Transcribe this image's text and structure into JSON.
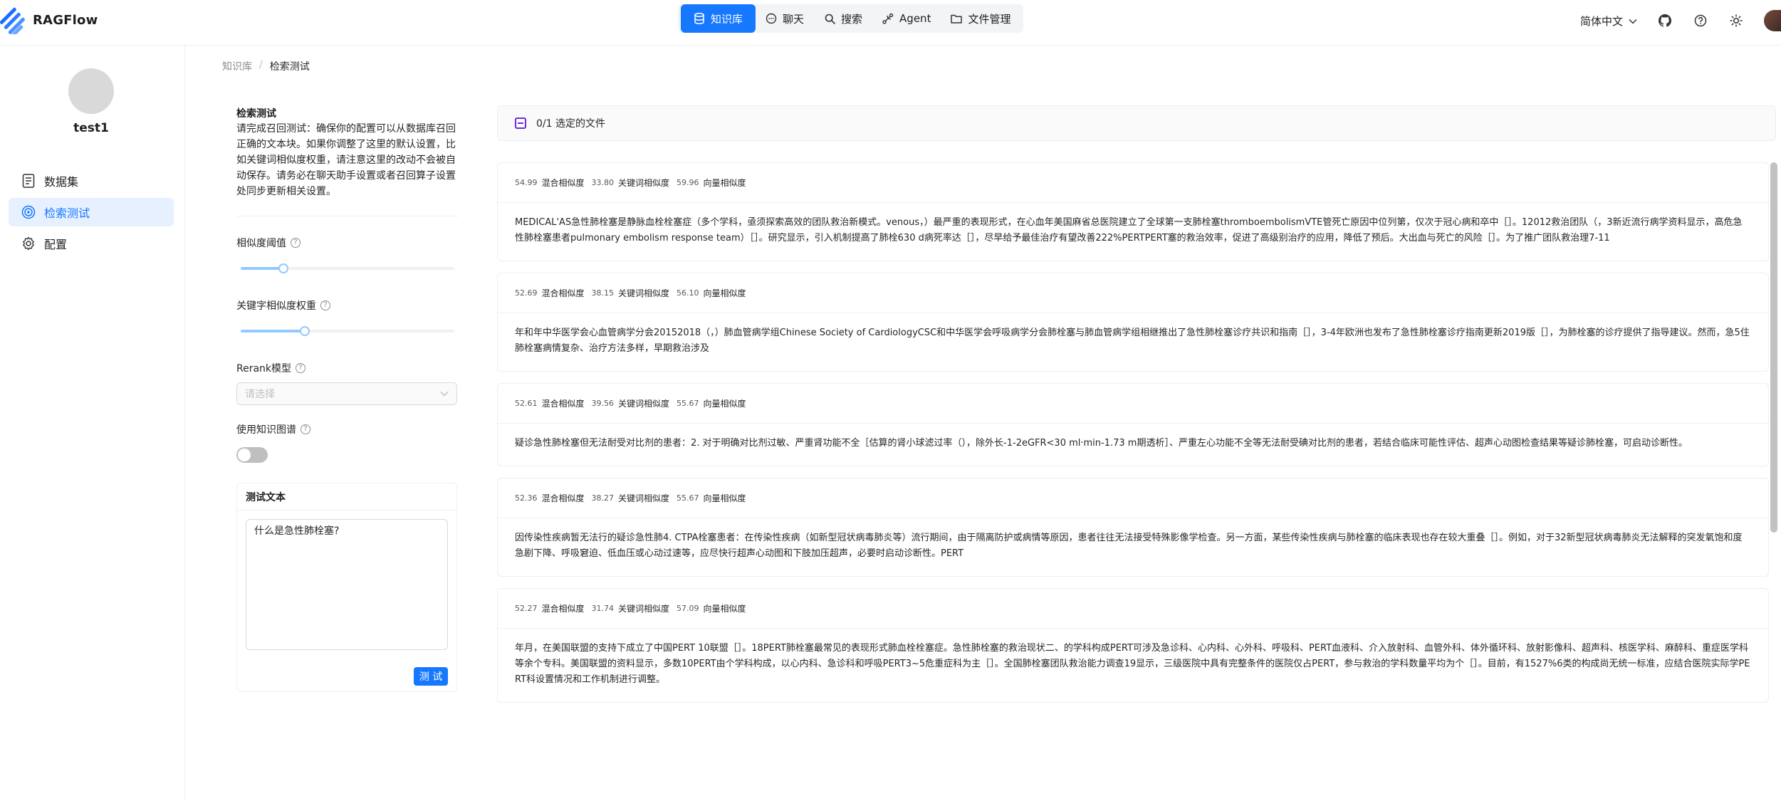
{
  "app": {
    "name": "RAGFlow"
  },
  "nav": {
    "items": [
      {
        "label": "知识库",
        "icon": "database-icon",
        "active": true
      },
      {
        "label": "聊天",
        "icon": "chat-icon",
        "active": false
      },
      {
        "label": "搜索",
        "icon": "search-icon",
        "active": false
      },
      {
        "label": "Agent",
        "icon": "agent-icon",
        "active": false
      },
      {
        "label": "文件管理",
        "icon": "folder-icon",
        "active": false
      }
    ]
  },
  "header": {
    "language": "简体中文"
  },
  "sidebar": {
    "kb_name": "test1",
    "items": [
      {
        "label": "数据集",
        "icon": "document-icon",
        "active": false
      },
      {
        "label": "检索测试",
        "icon": "target-icon",
        "active": true
      },
      {
        "label": "配置",
        "icon": "gear-icon",
        "active": false
      }
    ]
  },
  "breadcrumb": {
    "root": "知识库",
    "current": "检索测试"
  },
  "settings": {
    "title": "检索测试",
    "description": "请完成召回测试：确保你的配置可以从数据库召回正确的文本块。如果你调整了这里的默认设置，比如关键词相似度权重，请注意这里的改动不会被自动保存。请务必在聊天助手设置或者召回算子设置处同步更新相关设置。",
    "similarity_threshold": {
      "label": "相似度阈值",
      "value_fraction": 0.2
    },
    "keyword_weight": {
      "label": "关键字相似度权重",
      "value_fraction": 0.3
    },
    "rerank": {
      "label": "Rerank模型",
      "placeholder": "请选择"
    },
    "knowledge_graph": {
      "label": "使用知识图谱",
      "enabled": false
    },
    "test_text": {
      "title": "测试文本",
      "value": "什么是急性肺栓塞?",
      "button": "测 试"
    }
  },
  "results": {
    "selected_files": "0/1  选定的文件",
    "labels": {
      "hybrid": "混合相似度",
      "keyword": "关键词相似度",
      "vector": "向量相似度"
    },
    "items": [
      {
        "hybrid": "54.99",
        "keyword": "33.80",
        "vector": "59.96",
        "text": "MEDICAL'AS急性肺栓塞是静脉血栓栓塞症（多个学科，亟须探索高效的团队救治新模式。venous，）最严重的表现形式，在心血年美国麻省总医院建立了全球第一支肺栓塞thromboembolismVTE管死亡原因中位列第，仅次于冠心病和卒中［］。12012救治团队（，3新近流行病学资料显示，高危急性肺栓塞患者pulmonary embolism response team）［］。研究显示，引入机制提高了肺栓630 d病死率达［］，尽早给予最佳治疗有望改善222%PERTPERT塞的救治效率，促进了高级别治疗的应用，降低了预后。大出血与死亡的风险［］。为了推广团队救治理7-11"
      },
      {
        "hybrid": "52.69",
        "keyword": "38.15",
        "vector": "56.10",
        "text": "年和年中华医学会心血管病学分会20152018（，）肺血管病学组Chinese Society of CardiologyCSC和中华医学会呼吸病学分会肺栓塞与肺血管病学组相继推出了急性肺栓塞诊疗共识和指南［］，3-4年欧洲也发布了急性肺栓塞诊疗指南更新2019版［］，为肺栓塞的诊疗提供了指导建议。然而，急5住肺栓塞病情复杂、治疗方法多样，早期救治涉及"
      },
      {
        "hybrid": "52.61",
        "keyword": "39.56",
        "vector": "55.67",
        "text": "疑诊急性肺栓塞但无法耐受对比剂的患者：2. 对于明确对比剂过敏、严重肾功能不全［估算的肾小球滤过率（），除外长-1-2eGFR<30 ml·min-1.73 m期透析］、严重左心功能不全等无法耐受碘对比剂的患者，若结合临床可能性评估、超声心动图检查结果等疑诊肺栓塞，可启动诊断性。"
      },
      {
        "hybrid": "52.36",
        "keyword": "38.27",
        "vector": "55.67",
        "text": "因传染性疾病暂无法行的疑诊急性肺4. CTPA栓塞患者：在传染性疾病（如新型冠状病毒肺炎等）流行期间，由于隔离防护或病情等原因，患者往往无法接受特殊影像学检查。另一方面，某些传染性疾病与肺栓塞的临床表现也存在较大重叠［］。例如，对于32新型冠状病毒肺炎无法解释的突发氧饱和度急剧下降、呼吸窘迫、低血压或心动过速等，应尽快行超声心动图和下肢加压超声，必要时启动诊断性。PERT"
      },
      {
        "hybrid": "52.27",
        "keyword": "31.74",
        "vector": "57.09",
        "text": "年月，在美国联盟的支持下成立了中国PERT 10联盟［］。18PERT肺栓塞最常见的表现形式肺血栓栓塞症。急性肺栓塞的救治现状二、的学科构成PERT可涉及急诊科、心内科、心外科、呼吸科、PERT血液科、介入放射科、血管外科、体外循环科、放射影像科、超声科、核医学科、麻醉科、重症医学科等余个专科。美国联盟的资料显示，多数10PERT由个学科构成，以心内科、急诊科和呼吸PERT3~5危重症科为主［］。全国肺栓塞团队救治能力调查19显示，三级医院中具有完整条件的医院仅占PERT，参与救治的学科数量平均为个［］。目前，有1527%6类的构成尚无统一标准，应结合医院实际学PERT科设置情况和工作机制进行调整。"
      }
    ]
  },
  "colors": {
    "accent": "#1677ff",
    "selection": "#722ed1",
    "active_bg": "#e6f0ff"
  }
}
